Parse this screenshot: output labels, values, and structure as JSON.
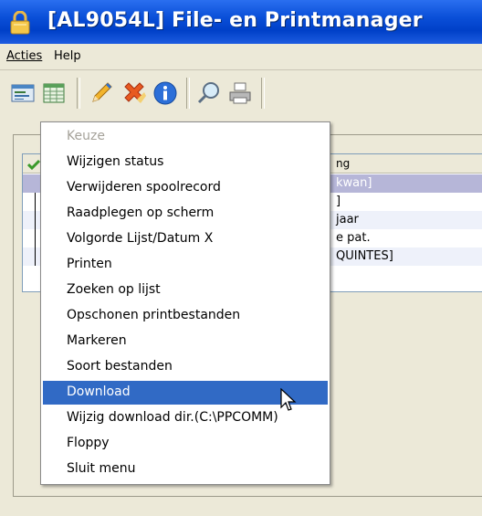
{
  "window": {
    "title": "[AL9054L] File- en Printmanager"
  },
  "menubar": {
    "items": [
      {
        "label": "Acties"
      },
      {
        "label": "Help"
      }
    ]
  },
  "toolbar": {
    "buttons": [
      {
        "icon": "list-card-icon"
      },
      {
        "icon": "spreadsheet-icon"
      },
      {
        "icon": "pencil-icon"
      },
      {
        "icon": "delete-x-icon"
      },
      {
        "icon": "info-icon"
      },
      {
        "icon": "magnifier-icon"
      },
      {
        "icon": "printer-icon"
      }
    ]
  },
  "grid": {
    "header_partial": "ng",
    "rows": [
      {
        "text": "kwan]",
        "selected": true
      },
      {
        "text": "]",
        "selected": false
      },
      {
        "text": "jaar",
        "selected": false
      },
      {
        "text": "e pat.",
        "selected": false
      },
      {
        "text": "QUINTES]",
        "selected": false
      }
    ]
  },
  "context_menu": {
    "items": [
      {
        "label": "Keuze",
        "disabled": true
      },
      {
        "label": "Wijzigen status"
      },
      {
        "label": "Verwijderen spoolrecord"
      },
      {
        "label": "Raadplegen op scherm"
      },
      {
        "label": "Volgorde Lijst/Datum X"
      },
      {
        "label": "Printen"
      },
      {
        "label": "Zoeken op lijst"
      },
      {
        "label": "Opschonen printbestanden"
      },
      {
        "label": "Markeren"
      },
      {
        "label": "Soort bestanden"
      },
      {
        "label": "Download",
        "highlighted": true
      },
      {
        "label": "Wijzig download dir.(C:\\PPCOMM)"
      },
      {
        "label": "Floppy"
      },
      {
        "label": "Sluit menu"
      }
    ]
  },
  "colors": {
    "titlebar": "#0a4fd8",
    "highlight": "#316ac5",
    "selected_row": "#b6b6d8"
  }
}
